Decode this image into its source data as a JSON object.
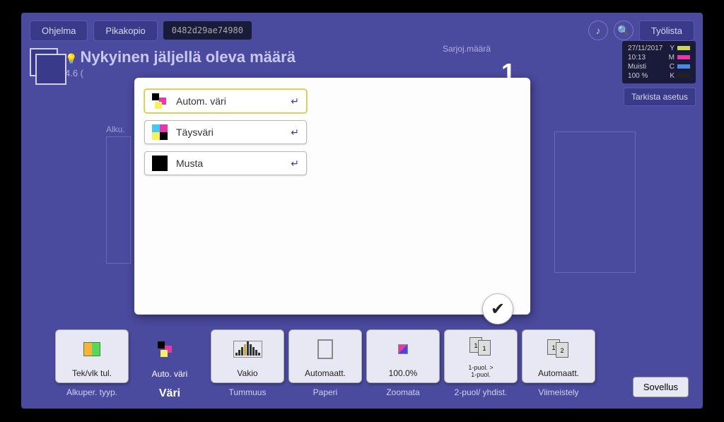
{
  "topbar": {
    "program": "Ohjelma",
    "quickcopy": "Pikakopio",
    "code": "0482d29ae74980",
    "joblist": "Työlista"
  },
  "title": {
    "main": "Nykyinen jäljellä oleva määrä",
    "sub": "4.6 (",
    "sets_label": "Sarjoj.määrä",
    "sets_value": "1"
  },
  "status": {
    "date": "27/11/2017",
    "time": "10:13",
    "memory_label": "Muisti",
    "memory_value": "100 %",
    "Y": "Y",
    "M": "M",
    "C": "C",
    "K": "K",
    "check": "Tarkista asetus"
  },
  "preview_label": "Alku.",
  "popup": {
    "items": [
      {
        "label": "Autom. väri"
      },
      {
        "label": "Täysväri"
      },
      {
        "label": "Musta"
      }
    ]
  },
  "tiles": [
    {
      "label": "Tek/vlk tul."
    },
    {
      "label": "Auto. väri"
    },
    {
      "label": "Vakio"
    },
    {
      "label": "Automaatt."
    },
    {
      "label": "100.0%"
    },
    {
      "label_l1": "1-puol. >",
      "label_l2": "1-puol."
    },
    {
      "label": "Automaatt."
    }
  ],
  "categories": [
    "Alkuper. tyyp.",
    "Väri",
    "Tummuus",
    "Paperi",
    "Zoomata",
    "2-puol/ yhdist.",
    "Viimeistely"
  ],
  "app_button": "Sovellus"
}
